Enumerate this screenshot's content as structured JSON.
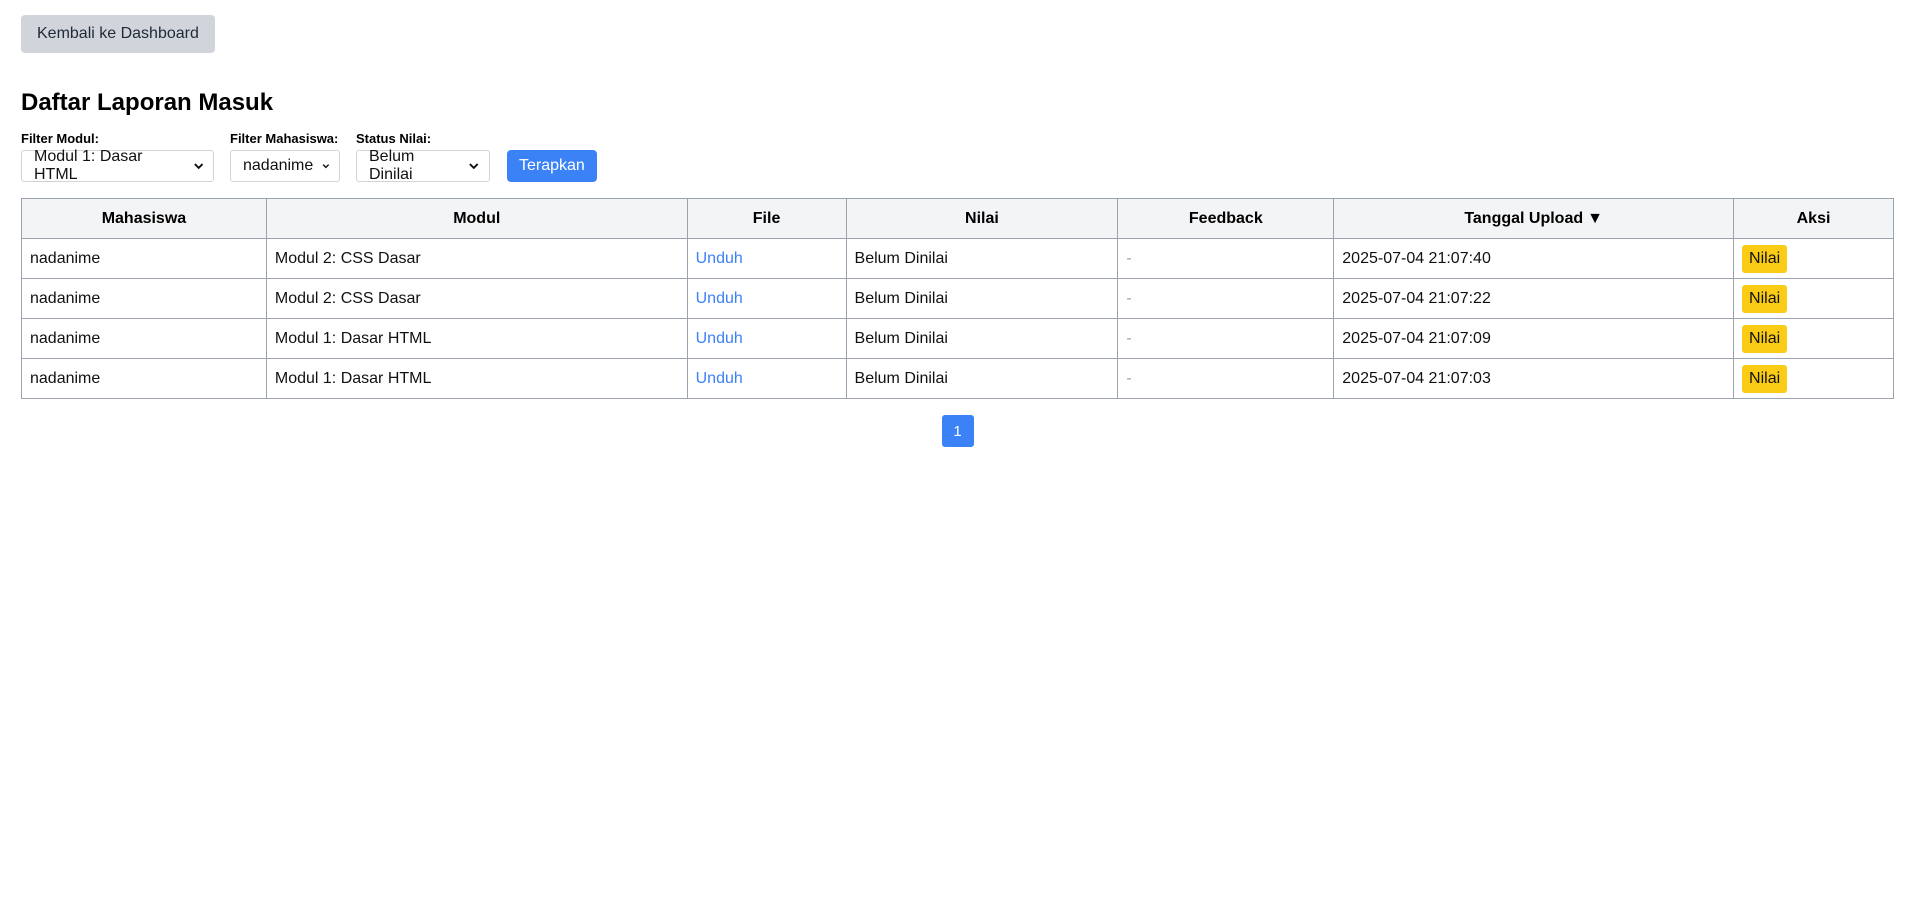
{
  "header": {
    "back_label": "Kembali ke Dashboard",
    "title": "Daftar Laporan Masuk"
  },
  "filters": {
    "modul_label": "Filter Modul:",
    "modul_value": "Modul 1: Dasar HTML",
    "mahasiswa_label": "Filter Mahasiswa:",
    "mahasiswa_value": "nadanime",
    "status_label": "Status Nilai:",
    "status_value": "Belum Dinilai",
    "apply_label": "Terapkan"
  },
  "table": {
    "columns": [
      "Mahasiswa",
      "Modul",
      "File",
      "Nilai",
      "Feedback",
      "Tanggal Upload",
      "Aksi"
    ],
    "sort_indicator": "▼",
    "rows": [
      {
        "mahasiswa": "nadanime",
        "modul": "Modul 2: CSS Dasar",
        "file": "Unduh",
        "nilai": "Belum Dinilai",
        "feedback": "-",
        "tanggal": "2025-07-04 21:07:40",
        "aksi": "Nilai"
      },
      {
        "mahasiswa": "nadanime",
        "modul": "Modul 2: CSS Dasar",
        "file": "Unduh",
        "nilai": "Belum Dinilai",
        "feedback": "-",
        "tanggal": "2025-07-04 21:07:22",
        "aksi": "Nilai"
      },
      {
        "mahasiswa": "nadanime",
        "modul": "Modul 1: Dasar HTML",
        "file": "Unduh",
        "nilai": "Belum Dinilai",
        "feedback": "-",
        "tanggal": "2025-07-04 21:07:09",
        "aksi": "Nilai"
      },
      {
        "mahasiswa": "nadanime",
        "modul": "Modul 1: Dasar HTML",
        "file": "Unduh",
        "nilai": "Belum Dinilai",
        "feedback": "-",
        "tanggal": "2025-07-04 21:07:03",
        "aksi": "Nilai"
      }
    ]
  },
  "pagination": {
    "current_page": "1"
  },
  "colors": {
    "primary": "#3b82f6",
    "warning": "#facc15",
    "muted": "#d1d5db"
  }
}
